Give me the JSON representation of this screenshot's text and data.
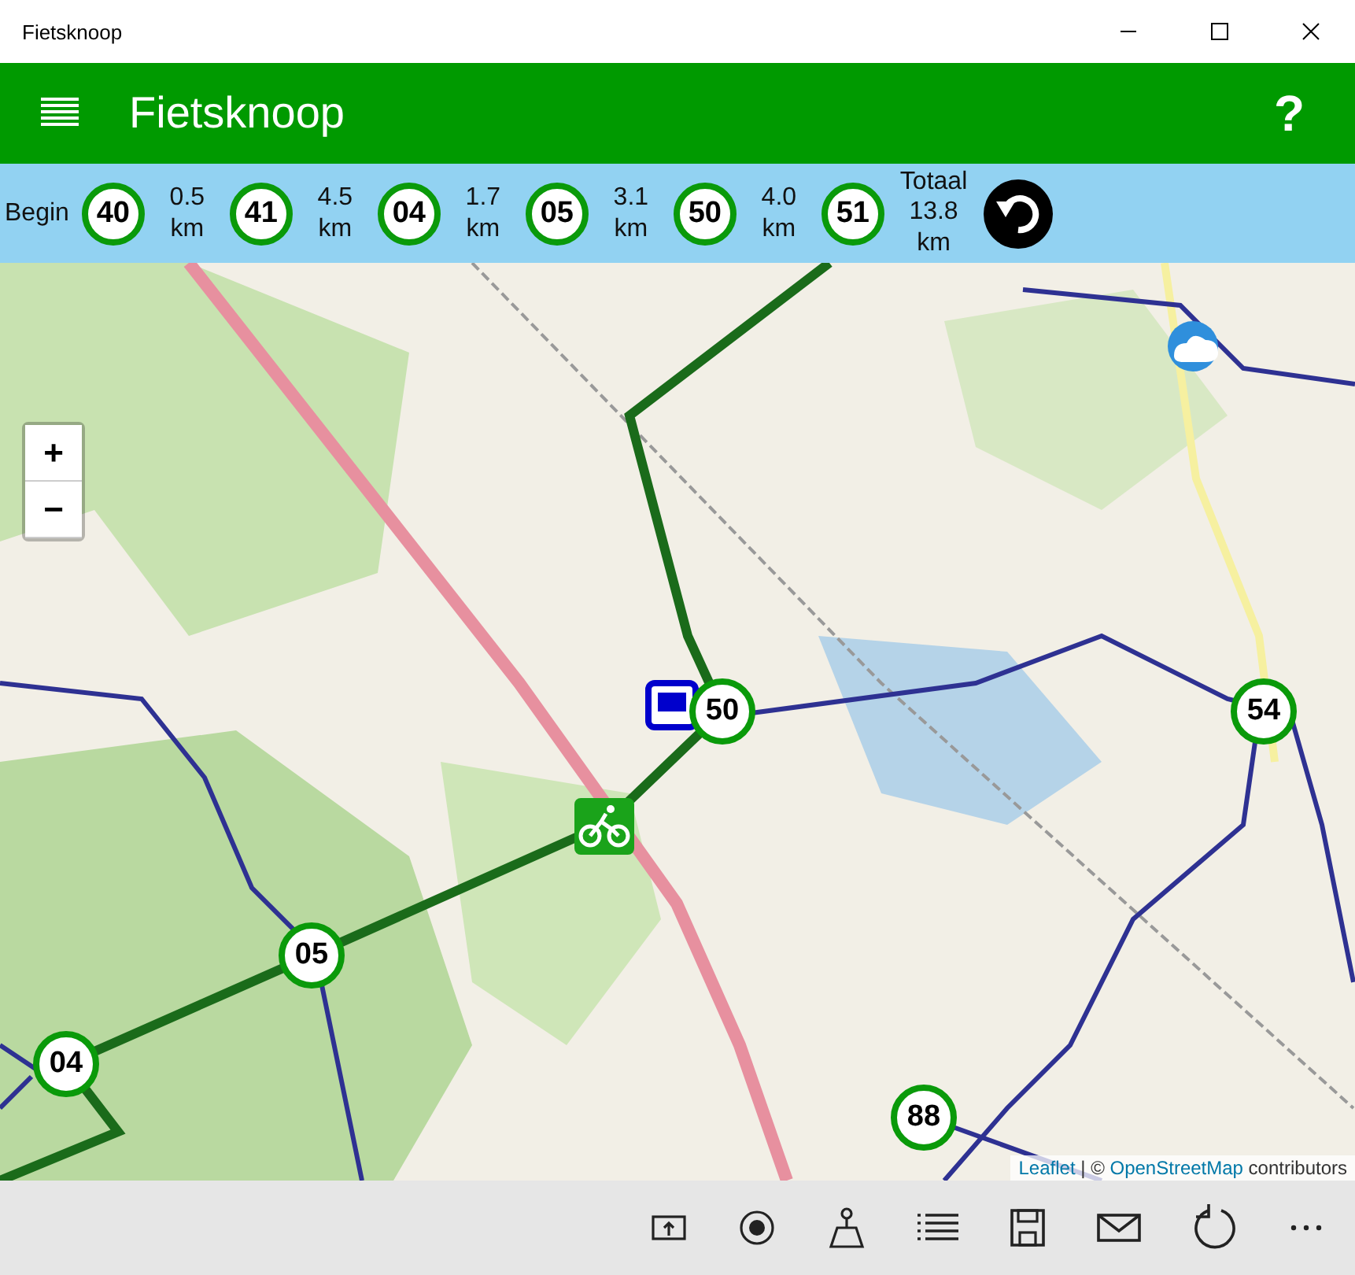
{
  "window": {
    "title": "Fietsknoop"
  },
  "header": {
    "title": "Fietsknoop",
    "help": "?"
  },
  "route": {
    "start": "Begin",
    "legs": [
      {
        "node": "40",
        "distance": "0.5 km"
      },
      {
        "node": "41",
        "distance": "4.5 km"
      },
      {
        "node": "04",
        "distance": "1.7 km"
      },
      {
        "node": "05",
        "distance": "3.1 km"
      },
      {
        "node": "50",
        "distance": "4.0 km"
      },
      {
        "node": "51"
      }
    ],
    "total_label": "Totaal",
    "total": "13.8 km"
  },
  "map": {
    "zoom_in": "+",
    "zoom_out": "−",
    "markers": [
      {
        "node": "50"
      },
      {
        "node": "54"
      },
      {
        "node": "05"
      },
      {
        "node": "04"
      },
      {
        "node": "88"
      }
    ],
    "attribution": {
      "link_1": "Leaflet",
      "separator": "| ©",
      "link_2": "OpenStreetMap",
      "suffix": "contributors"
    }
  }
}
